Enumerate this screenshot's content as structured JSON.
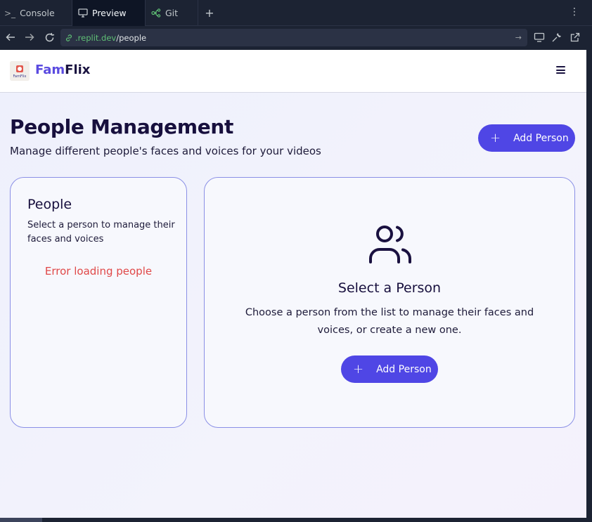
{
  "tabs": [
    {
      "label": "Console",
      "icon": "terminal-icon"
    },
    {
      "label": "Preview",
      "icon": "monitor-icon"
    },
    {
      "label": "Git",
      "icon": "git-branch-icon"
    }
  ],
  "tab_add": "+",
  "url": {
    "host": ".replit.dev",
    "path": "/people"
  },
  "app": {
    "brand_part1": "Fam",
    "brand_part2": "Flix",
    "logo_text": "FamFlix"
  },
  "page": {
    "title": "People Management",
    "subtitle": "Manage different people's faces and voices for your videos",
    "add_person_label": "Add Person"
  },
  "people_panel": {
    "title": "People",
    "description": "Select a person to manage their faces and voices",
    "error": "Error loading people"
  },
  "empty_state": {
    "title": "Select a Person",
    "description": "Choose a person from the list to manage their faces and voices, or create a new one.",
    "button_label": "Add Person"
  },
  "colors": {
    "accent": "#4f46e5",
    "error": "#e04848",
    "brand_fam": "#5b4be0"
  }
}
